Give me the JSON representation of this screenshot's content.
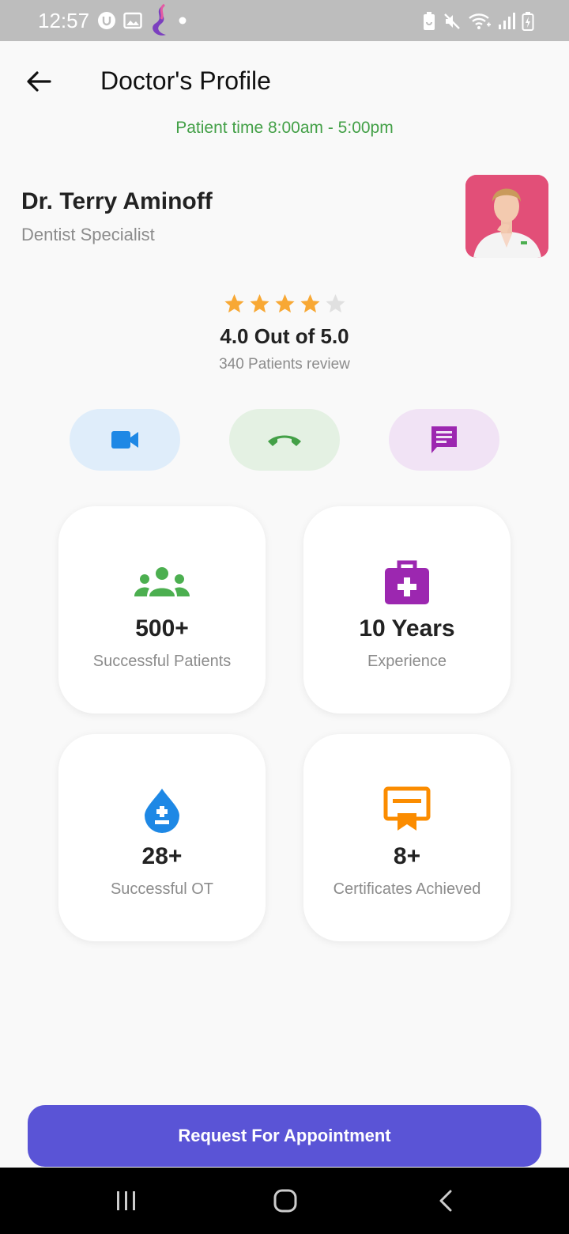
{
  "status_bar": {
    "time": "12:57",
    "left_icons": [
      "notification-badge-icon",
      "gallery-icon",
      "app-logo-icon",
      "dot-icon"
    ],
    "right_icons": [
      "battery-saver-icon",
      "mute-icon",
      "wifi-icon",
      "signal-icon",
      "battery-charging-icon"
    ]
  },
  "header": {
    "title": "Doctor's Profile",
    "back_icon": "arrow-left-icon"
  },
  "patient_time": "Patient time 8:00am - 5:00pm",
  "doctor": {
    "name": "Dr. Terry Aminoff",
    "specialty": "Dentist Specialist"
  },
  "rating": {
    "stars_filled": 4,
    "stars_total": 5,
    "text": "4.0 Out of 5.0",
    "reviews": "340 Patients review"
  },
  "contact_actions": [
    {
      "icon": "video-camera-icon",
      "color": "#1e88e5"
    },
    {
      "icon": "phone-icon",
      "color": "#43a047"
    },
    {
      "icon": "chat-icon",
      "color": "#9c27b0"
    }
  ],
  "stats": [
    {
      "icon": "group-icon",
      "color": "#4caf50",
      "value": "500+",
      "label": "Successful Patients"
    },
    {
      "icon": "medical-bag-icon",
      "color": "#9c27b0",
      "value": "10 Years",
      "label": "Experience"
    },
    {
      "icon": "blood-drop-icon",
      "color": "#1e88e5",
      "value": "28+",
      "label": "Successful OT"
    },
    {
      "icon": "certificate-icon",
      "color": "#fb8c00",
      "value": "8+",
      "label": "Certificates Achieved"
    }
  ],
  "cta": {
    "label": "Request For Appointment"
  },
  "colors": {
    "accent": "#5a54d6",
    "patient_time": "#43a047",
    "star": "#f8a834",
    "star_empty": "#e0e0e0"
  }
}
